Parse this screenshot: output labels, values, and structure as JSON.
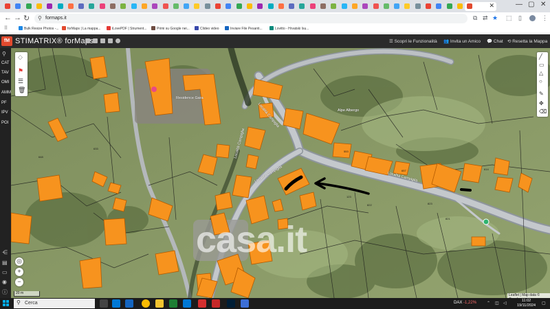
{
  "browser": {
    "active_tab_label": "",
    "url": "formaps.it",
    "bookmarks": [
      "Bulk Resize Photos -...",
      "forMaps | La mappa...",
      "iLovePDF | Strument...",
      "Primi su Google nei...",
      "Clideo video",
      "Inviare File Pesanti...",
      "Lovitto - Hrvatski Isu..."
    ]
  },
  "app": {
    "logo_text": "fM",
    "brand": "STIMATRIX® forMaps",
    "header_links": {
      "features": "Scopri le Funzionalità",
      "invite": "Invita un Amico",
      "chat": "Chat",
      "reset": "Resetta la Mappa"
    },
    "sidebar_items": [
      "CAT",
      "TAV",
      "OMI",
      "AMM",
      "PF",
      "IPV",
      "POI"
    ]
  },
  "map": {
    "watermark": "casa.it",
    "scale_label": "20 m",
    "attribution": "Leaflet | Map data © Google",
    "labels": {
      "road1": "Località Campiglia",
      "road2": "Località Campiglia",
      "road3": "Località Campiglia",
      "road4": "Località Campiglia",
      "poi1": "Residence Gara",
      "poi2": "Alpe Albergo"
    },
    "colors": {
      "parcel": "#f7931e",
      "parcel_border": "#b35a00",
      "cadastre_line": "#1a1a1a",
      "road": "#b9bdc2"
    }
  },
  "taskbar": {
    "search_placeholder": "Cerca",
    "ticker_name": "DAX",
    "ticker_change": "-1,22%",
    "time": "11:02",
    "date": "19/11/2024"
  }
}
